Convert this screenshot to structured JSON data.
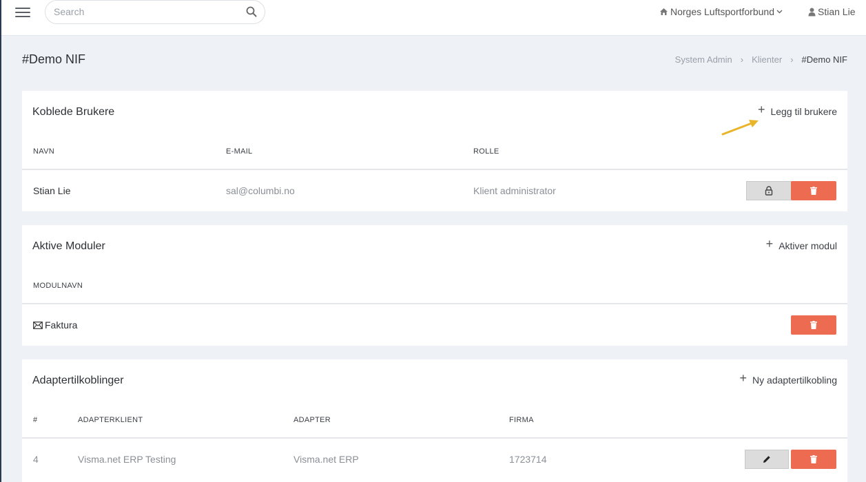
{
  "topbar": {
    "search_placeholder": "Search",
    "organization": "Norges Luftsportforbund",
    "user": "Stian Lie"
  },
  "page": {
    "title": "#Demo NIF",
    "breadcrumb": [
      "System Admin",
      "Klienter",
      "#Demo NIF"
    ]
  },
  "users_card": {
    "title": "Koblede Brukere",
    "action": "Legg til brukere",
    "columns": [
      "NAVN",
      "E-MAIL",
      "ROLLE"
    ],
    "rows": [
      {
        "name": "Stian Lie",
        "email": "sal@columbi.no",
        "role": "Klient administrator"
      }
    ]
  },
  "modules_card": {
    "title": "Aktive Moduler",
    "action": "Aktiver modul",
    "columns": [
      "MODULNAVN"
    ],
    "rows": [
      {
        "name": "Faktura"
      }
    ]
  },
  "adapters_card": {
    "title": "Adaptertilkoblinger",
    "action": "Ny adaptertilkobling",
    "columns": [
      "#",
      "ADAPTERKLIENT",
      "ADAPTER",
      "FIRMA"
    ],
    "rows": [
      {
        "id": "4",
        "client": "Visma.net ERP Testing",
        "adapter": "Visma.net ERP",
        "firma": "1723714"
      }
    ]
  },
  "colors": {
    "danger": "#ed6b51",
    "arrow": "#e8b52a"
  },
  "icons": {
    "menu": "hamburger-icon",
    "search": "search-icon",
    "org": "home-icon",
    "user": "user-icon",
    "lock": "lock-icon",
    "delete": "trash-icon",
    "edit": "pencil-icon",
    "module": "envelope-icon"
  }
}
